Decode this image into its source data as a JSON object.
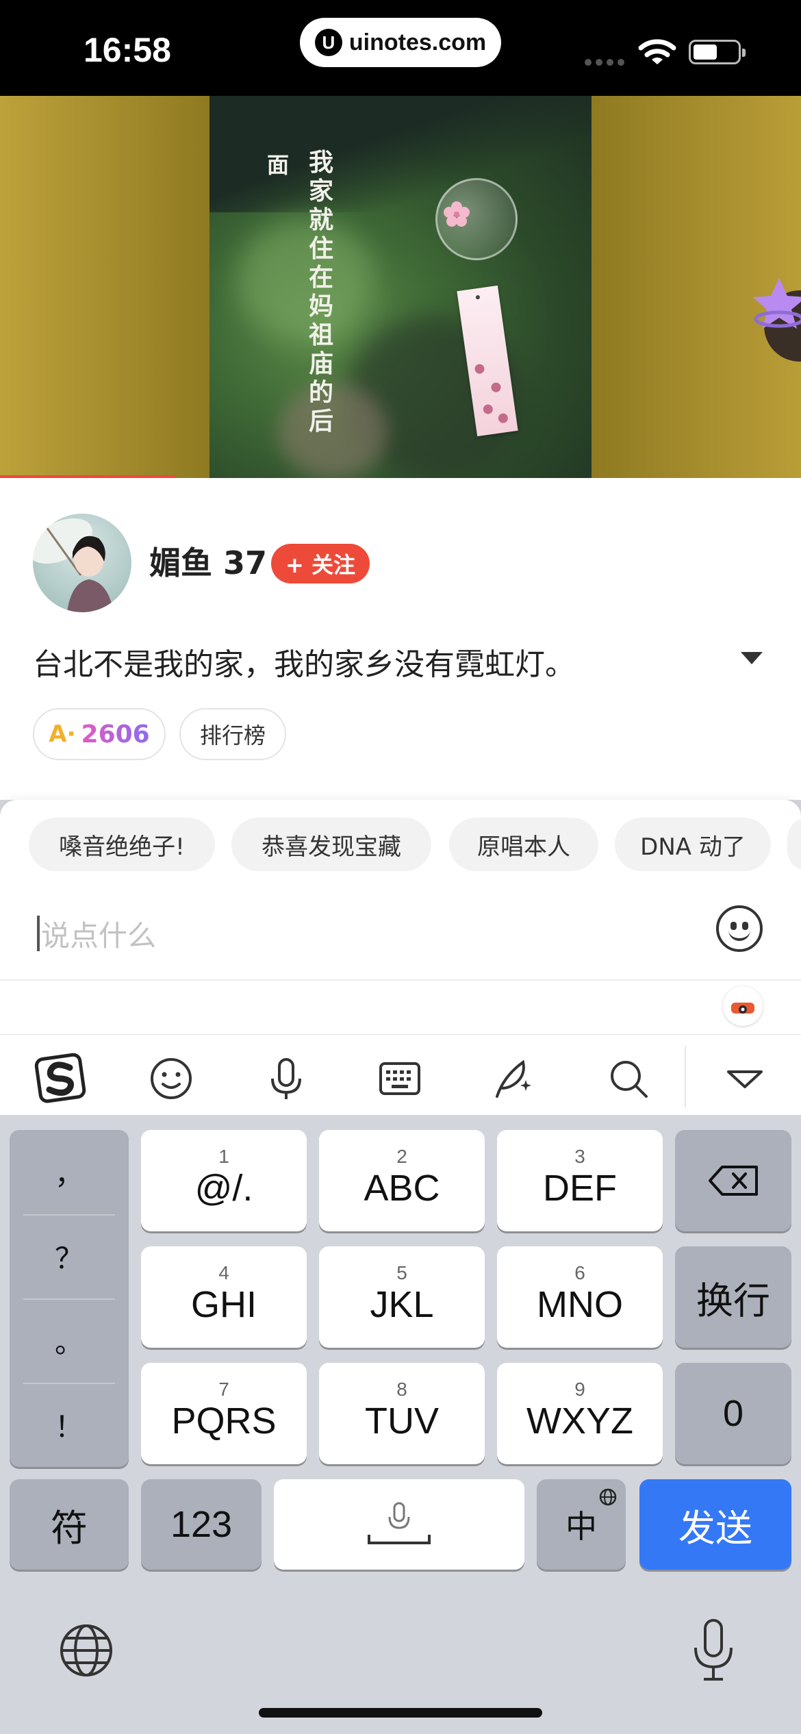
{
  "status_bar": {
    "time": "16:58",
    "url": "uinotes.com",
    "url_logo": "U",
    "icons": [
      "signal-dots-icon",
      "wifi-icon",
      "battery-icon"
    ]
  },
  "video": {
    "poem_main": "我家就住在妈祖庙的后",
    "poem_side": "面",
    "progress_fraction": 0.22
  },
  "author": {
    "name": "媚鱼 37",
    "follow_label": "+ 关注"
  },
  "post": {
    "description": "台北不是我的家，我的家乡没有霓虹灯。"
  },
  "stats": {
    "score_prefix": "A·",
    "score": "2606",
    "rank_label": "排行榜"
  },
  "quick_replies": [
    "嗓音绝绝子!",
    "恭喜发现宝藏",
    "原唱本人",
    "DNA 动了"
  ],
  "comment": {
    "placeholder": "说点什么"
  },
  "ime_toolbar": {
    "items": [
      "sogou-logo-icon",
      "emoji-icon",
      "microphone-icon",
      "keyboard-icon",
      "quill-ai-icon",
      "search-icon",
      "collapse-keyboard-icon"
    ]
  },
  "keyboard": {
    "punctuation": [
      "，",
      "？",
      "。",
      "！"
    ],
    "keys": [
      {
        "num": "1",
        "label": "@/."
      },
      {
        "num": "2",
        "label": "ABC"
      },
      {
        "num": "3",
        "label": "DEF"
      },
      {
        "num": "4",
        "label": "GHI"
      },
      {
        "num": "5",
        "label": "JKL"
      },
      {
        "num": "6",
        "label": "MNO"
      },
      {
        "num": "7",
        "label": "PQRS"
      },
      {
        "num": "8",
        "label": "TUV"
      },
      {
        "num": "9",
        "label": "WXYZ"
      }
    ],
    "newline_label": "换行",
    "zero_label": "0",
    "symbol_label": "符",
    "numbers_label": "123",
    "lang_label": "中",
    "send_label": "发送"
  },
  "colors": {
    "accent_red": "#ee4a3a",
    "send_blue": "#3478f6",
    "key_gray": "#abb0ba"
  }
}
